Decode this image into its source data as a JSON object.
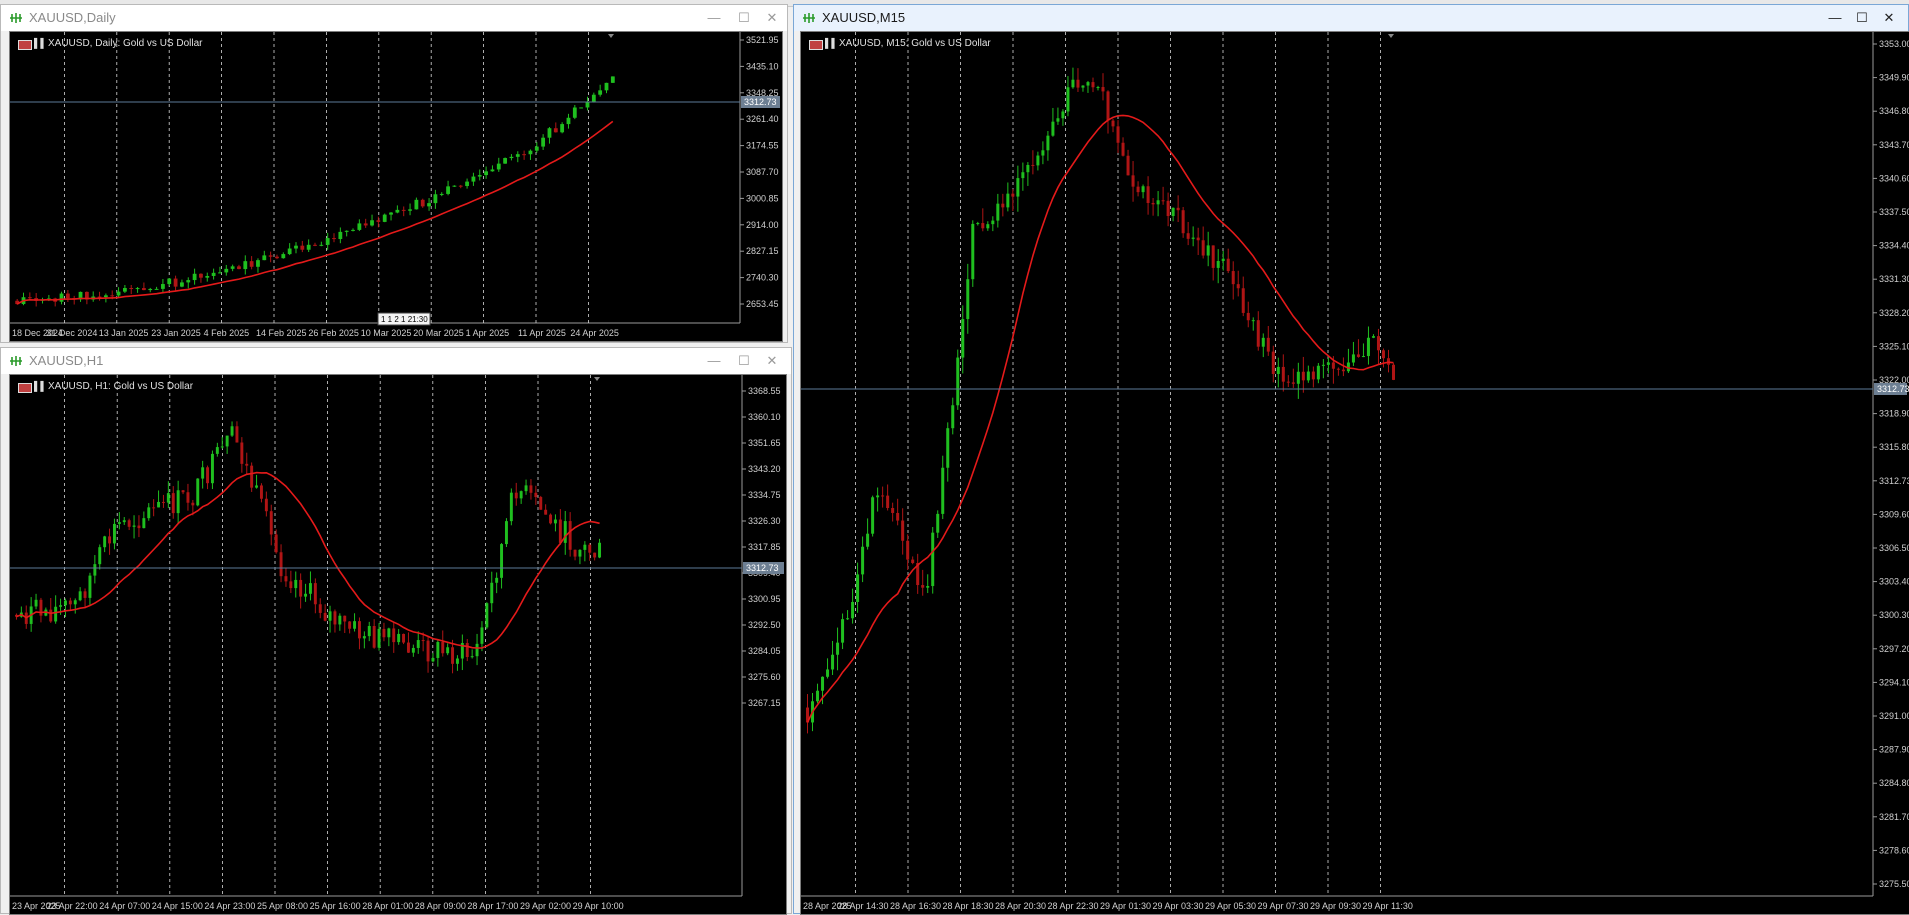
{
  "windows": {
    "daily": {
      "title": "XAUUSD,Daily",
      "label": "XAUUSD, Daily:  Gold vs US Dollar",
      "price_labels": [
        "3521.95",
        "3435.10",
        "3348.25",
        "3261.40",
        "3174.55",
        "3087.70",
        "3000.85",
        "2914.00",
        "2827.15",
        "2740.30",
        "2653.45"
      ],
      "current_price": "3312.73",
      "time_labels": [
        "18 Dec 2024",
        "31 Dec 2024",
        "13 Jan 2025",
        "23 Jan 2025",
        "4 Feb 2025",
        "14 Feb 2025",
        "26 Feb 2025",
        "10 Mar 2025",
        "20 Mar 2025",
        "1 Apr 2025",
        "11 Apr 2025",
        "24 Apr 2025"
      ],
      "countdown": "1 1 2 1 21:30"
    },
    "h1": {
      "title": "XAUUSD,H1",
      "label": "XAUUSD, H1:  Gold vs US Dollar",
      "price_labels": [
        "3368.55",
        "3360.10",
        "3351.65",
        "3343.20",
        "3334.75",
        "3326.30",
        "3317.85",
        "3309.40",
        "3300.95",
        "3292.50",
        "3284.05",
        "3275.60",
        "3267.15"
      ],
      "current_price": "3312.73",
      "time_labels": [
        "23 Apr 2025",
        "23 Apr 22:00",
        "24 Apr 07:00",
        "24 Apr 15:00",
        "24 Apr 23:00",
        "25 Apr 08:00",
        "25 Apr 16:00",
        "28 Apr 01:00",
        "28 Apr 09:00",
        "28 Apr 17:00",
        "29 Apr 02:00",
        "29 Apr 10:00"
      ]
    },
    "m15": {
      "title": "XAUUSD,M15",
      "label": "XAUUSD, M15:  Gold vs US Dollar",
      "price_labels": [
        "3353.00",
        "3349.90",
        "3346.80",
        "3343.70",
        "3340.60",
        "3337.50",
        "3334.40",
        "3331.30",
        "3328.20",
        "3325.10",
        "3322.00",
        "3318.90",
        "3315.80",
        "3312.73",
        "3309.60",
        "3306.50",
        "3303.40",
        "3300.30",
        "3297.20",
        "3294.10",
        "3291.00",
        "3287.90",
        "3284.80",
        "3281.70",
        "3278.60",
        "3275.50"
      ],
      "current_price": "3312.73",
      "time_labels": [
        "28 Apr 2025",
        "28 Apr 14:30",
        "28 Apr 16:30",
        "28 Apr 18:30",
        "28 Apr 20:30",
        "28 Apr 22:30",
        "29 Apr 01:30",
        "29 Apr 03:30",
        "29 Apr 05:30",
        "29 Apr 07:30",
        "29 Apr 09:30",
        "29 Apr 11:30"
      ]
    }
  },
  "colors": {
    "bull": "#1fbf1f",
    "bear": "#b01515",
    "ma": "#e41a1a",
    "grid": "#d8d8d8",
    "price_line": "#5c7a99",
    "axis_text": "#d0d0d0"
  },
  "icons": {
    "window_icon": "chart-window-icon",
    "minimize": "minimize-icon",
    "maximize": "maximize-icon",
    "close": "close-icon"
  }
}
